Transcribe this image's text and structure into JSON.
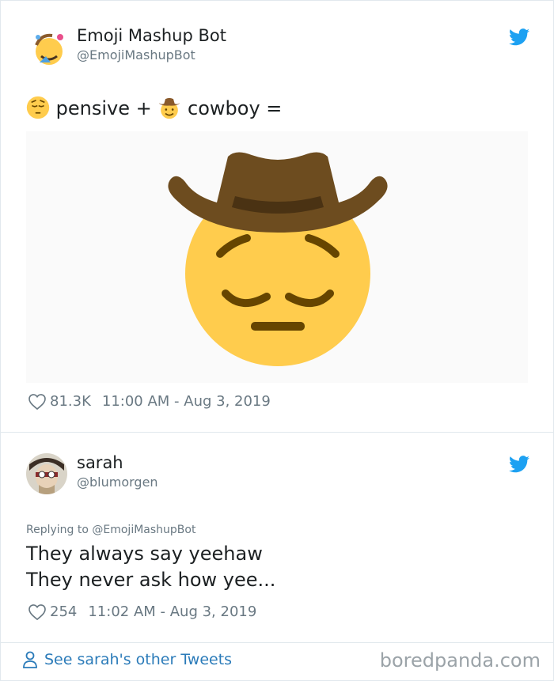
{
  "tweet1": {
    "name": "Emoji Mashup Bot",
    "handle": "@EmojiMashupBot",
    "text_part1": "pensive +",
    "text_part2": "cowboy =",
    "likes": "81.3K",
    "timestamp": "11:00 AM - Aug 3, 2019"
  },
  "tweet2": {
    "name": "sarah",
    "handle": "@blumorgen",
    "replying_to": "Replying to @EmojiMashupBot",
    "line1": "They always say yeehaw",
    "line2": "They never ask how yee...",
    "likes": "254",
    "timestamp": "11:02 AM - Aug 3, 2019"
  },
  "footer": {
    "other_tweets": "See sarah's other Tweets",
    "watermark": "boredpanda.com"
  },
  "colors": {
    "twitter_blue": "#1da1f2",
    "link_blue": "#2b7bb9",
    "emoji_yellow": "#ffcc4d",
    "hat_brown": "#6d4c1f",
    "meta_gray": "#697882"
  },
  "icons": [
    "twitter-bird-icon",
    "heart-icon",
    "person-icon"
  ]
}
